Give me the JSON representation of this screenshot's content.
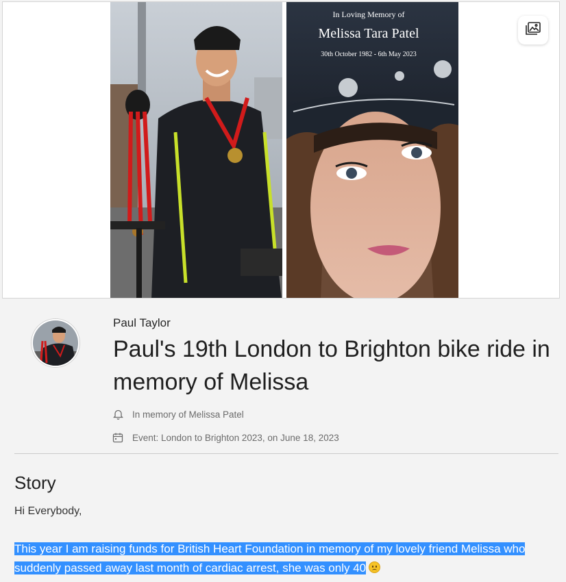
{
  "hero": {
    "left_photo_alt": "Cyclist holding medals",
    "right_photo_card": {
      "line1": "In Loving Memory of",
      "name": "Melissa Tara Patel",
      "dates": "30th October 1982 - 6th May 2023"
    },
    "gallery_icon": "image-gallery-icon"
  },
  "header": {
    "organiser": "Paul Taylor",
    "title": "Paul's 19th London to Brighton bike ride in memory of Melissa"
  },
  "meta": {
    "memory": {
      "icon": "bell-icon",
      "text": "In memory of Melissa Patel"
    },
    "event": {
      "icon": "calendar-icon",
      "text": "Event: London to Brighton 2023, on June 18, 2023"
    }
  },
  "story": {
    "heading": "Story",
    "greeting": "Hi Everybody,",
    "paragraph": "This year I am raising funds for British Heart Foundation in memory of my lovely friend Melissa who suddenly passed away last month of cardiac arrest, she was only 40",
    "emoji": "frowning-face"
  },
  "colors": {
    "page_bg": "#f3f3f3",
    "selection": "#3390ff",
    "text": "#202020",
    "muted": "#6b6b6b"
  }
}
